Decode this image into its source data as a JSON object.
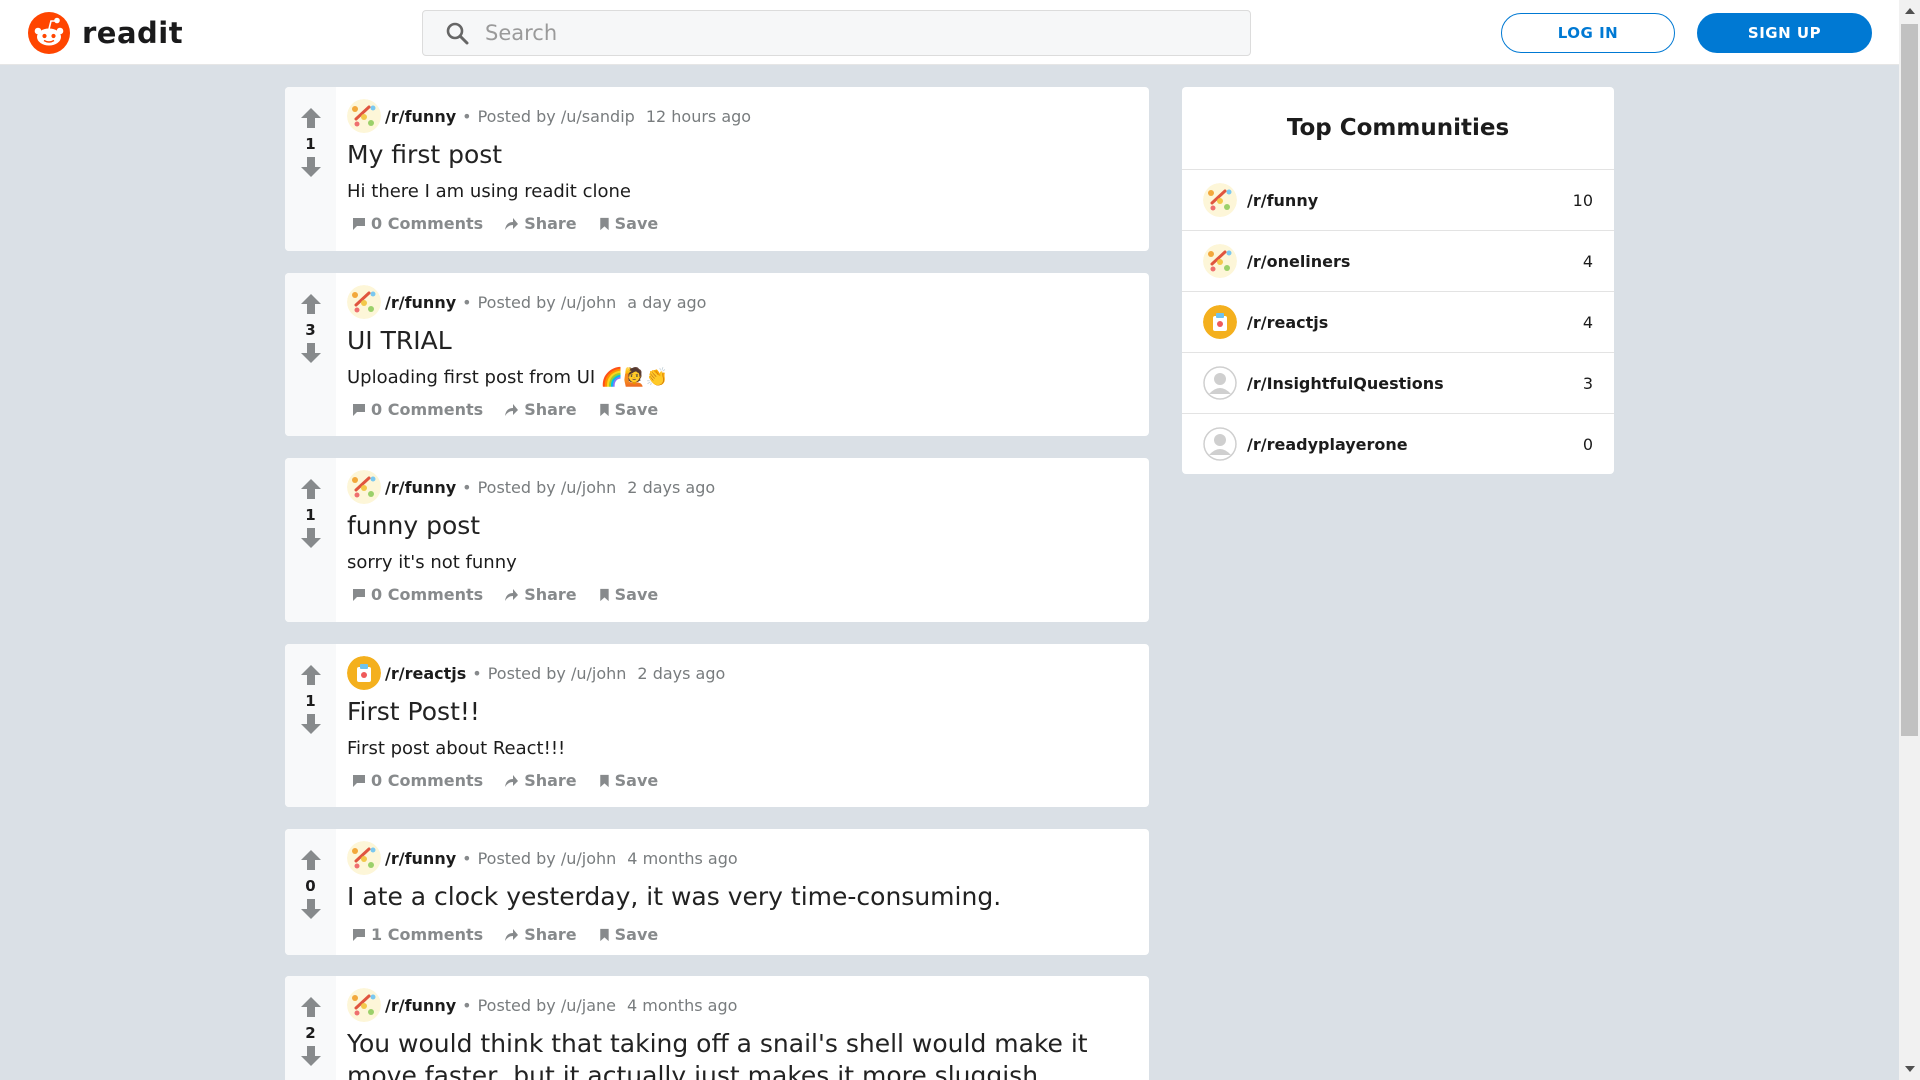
{
  "app": {
    "name": "readit"
  },
  "search": {
    "placeholder": "Search",
    "value": ""
  },
  "auth": {
    "login_label": "LOG IN",
    "signup_label": "SIGN UP"
  },
  "colors": {
    "brand": "#ff4500",
    "primary_button": "#0079d3",
    "background": "#dae0e6"
  },
  "posts": [
    {
      "subreddit": "/r/funny",
      "avatar": "funny-avatar-icon",
      "posted_by": "Posted by /u/sandip",
      "time": "12 hours ago",
      "score": "1",
      "title": "My first post",
      "text": "Hi there I am using readit clone",
      "comments": "0 Comments",
      "share": "Share",
      "save": "Save"
    },
    {
      "subreddit": "/r/funny",
      "avatar": "funny-avatar-icon",
      "posted_by": "Posted by /u/john",
      "time": "a day ago",
      "score": "3",
      "title": "UI TRIAL",
      "text": "Uploading first post from UI 🌈🙋👏",
      "comments": "0 Comments",
      "share": "Share",
      "save": "Save"
    },
    {
      "subreddit": "/r/funny",
      "avatar": "funny-avatar-icon",
      "posted_by": "Posted by /u/john",
      "time": "2 days ago",
      "score": "1",
      "title": "funny post",
      "text": "sorry it's not funny",
      "comments": "0 Comments",
      "share": "Share",
      "save": "Save"
    },
    {
      "subreddit": "/r/reactjs",
      "avatar": "reactjs-avatar-icon",
      "posted_by": "Posted by /u/john",
      "time": "2 days ago",
      "score": "1",
      "title": "First Post!!",
      "text": "First post about React!!!",
      "comments": "0 Comments",
      "share": "Share",
      "save": "Save"
    },
    {
      "subreddit": "/r/funny",
      "avatar": "funny-avatar-icon",
      "posted_by": "Posted by /u/john",
      "time": "4 months ago",
      "score": "0",
      "title": "I ate a clock yesterday, it was very time-consuming.",
      "text": "",
      "comments": "1 Comments",
      "share": "Share",
      "save": "Save"
    },
    {
      "subreddit": "/r/funny",
      "avatar": "funny-avatar-icon",
      "posted_by": "Posted by /u/jane",
      "time": "4 months ago",
      "score": "2",
      "title": "You would think that taking off a snail's shell would make it move faster, but it actually just makes it more sluggish",
      "text": "",
      "comments": "",
      "share": "",
      "save": ""
    }
  ],
  "sidebar": {
    "title": "Top Communities",
    "communities": [
      {
        "name": "/r/funny",
        "count": "10",
        "avatar": "funny-avatar-icon"
      },
      {
        "name": "/r/oneliners",
        "count": "4",
        "avatar": "funny-avatar-icon"
      },
      {
        "name": "/r/reactjs",
        "count": "4",
        "avatar": "reactjs-avatar-icon"
      },
      {
        "name": "/r/InsightfulQuestions",
        "count": "3",
        "avatar": "default-avatar-icon"
      },
      {
        "name": "/r/readyplayerone",
        "count": "0",
        "avatar": "default-avatar-icon"
      }
    ]
  }
}
